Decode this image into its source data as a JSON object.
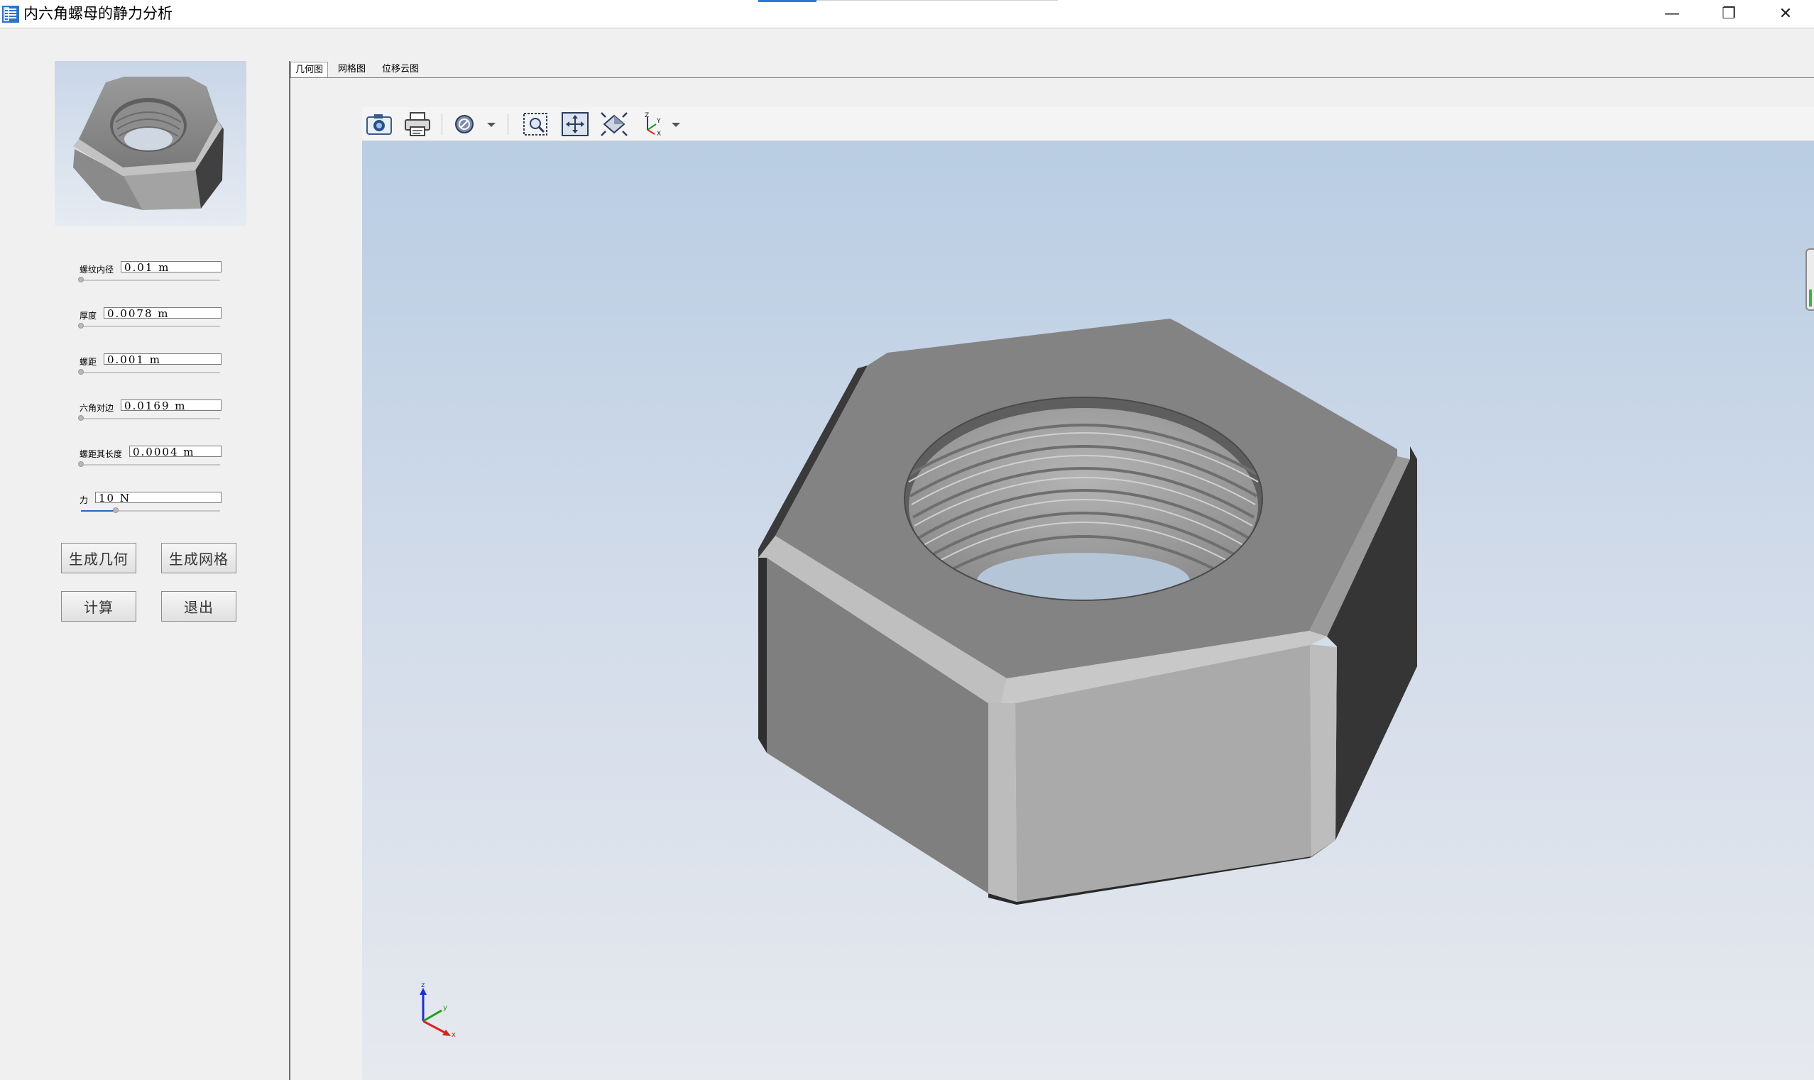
{
  "window": {
    "title": "内六角螺母的静力分析",
    "controls": {
      "minimize": "—",
      "maximize": "❐",
      "close": "✕"
    }
  },
  "parameters": [
    {
      "label": "螺纹内径",
      "value": "0.01 m",
      "slider": 0.0
    },
    {
      "label": "厚度",
      "value": "0.0078 m",
      "slider": 0.0
    },
    {
      "label": "螺距",
      "value": "0.001 m",
      "slider": 0.0
    },
    {
      "label": "六角对边",
      "value": "0.0169 m",
      "slider": 0.0
    },
    {
      "label": "螺距其长度",
      "value": "0.0004 m",
      "slider": 0.0
    },
    {
      "label": "力",
      "value": "10 N",
      "slider": 0.25
    }
  ],
  "buttons": {
    "generate_geometry": "生成几何",
    "generate_mesh": "生成网格",
    "compute": "计算",
    "exit": "退出"
  },
  "tabs": [
    {
      "label": "几何图",
      "active": true
    },
    {
      "label": "网格图",
      "active": false
    },
    {
      "label": "位移云图",
      "active": false
    }
  ],
  "toolbar": [
    {
      "icon": "camera-icon"
    },
    {
      "icon": "print-icon"
    },
    {
      "icon": "display-mode-icon",
      "dropdown": true
    },
    {
      "icon": "zoom-box-icon"
    },
    {
      "icon": "pan-icon"
    },
    {
      "icon": "fit-all-icon"
    },
    {
      "icon": "axes-view-icon",
      "dropdown": true
    }
  ],
  "viewer": {
    "triad_labels": {
      "z": "z",
      "y": "y",
      "x": "x"
    },
    "toolbar_axes_labels": {
      "z": "Z",
      "y": "Y",
      "x": "X"
    }
  },
  "colors": {
    "viewport_top": "#b9cde3",
    "viewport_bottom": "#e6e9ee",
    "accent": "#2b79d0",
    "slider_fill": "#2a63c5",
    "axis_x": "#e02020",
    "axis_y": "#18a018",
    "axis_z": "#2030d0"
  }
}
